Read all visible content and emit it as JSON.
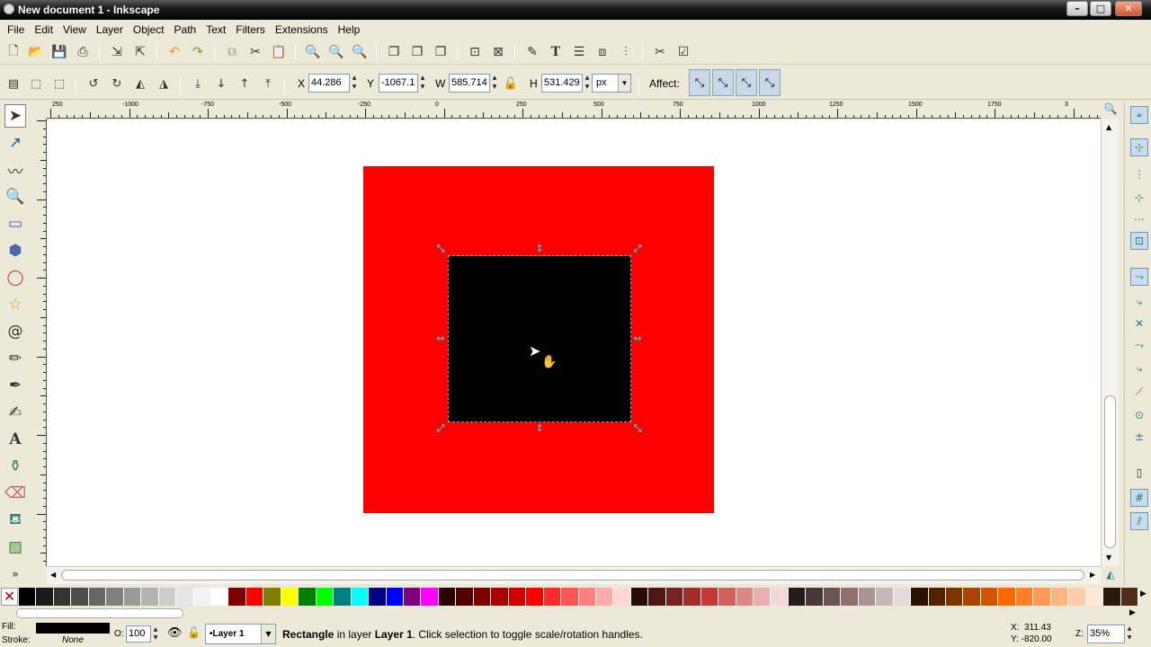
{
  "window": {
    "title": "New document 1 - Inkscape"
  },
  "menu": [
    "File",
    "Edit",
    "View",
    "Layer",
    "Object",
    "Path",
    "Text",
    "Filters",
    "Extensions",
    "Help"
  ],
  "icons": {
    "new": "document-new-icon",
    "open": "folder-open-icon",
    "save": "save-icon",
    "print": "print-icon",
    "import": "import-icon",
    "export": "export-icon",
    "undo": "undo-icon",
    "redo": "redo-icon"
  },
  "controls": {
    "x_label": "X",
    "x_value": "44.286",
    "y_label": "Y",
    "y_value": "-1067.1",
    "w_label": "W",
    "w_value": "585.714",
    "h_label": "H",
    "h_value": "531.429",
    "unit": "px",
    "affect_label": "Affect:"
  },
  "ruler": {
    "labels": [
      "250",
      "-1000",
      "-750",
      "-500",
      "-250",
      "0",
      "250",
      "500",
      "750",
      "1000",
      "1250",
      "1500",
      "1750",
      "3"
    ]
  },
  "canvas": {
    "background_rect_color": "#ff0000",
    "selected_rect_color": "#000000",
    "handle_color": "#35c0d0"
  },
  "palette": {
    "colors": [
      "#000000",
      "#1a1a1a",
      "#333333",
      "#4d4d4d",
      "#666666",
      "#808080",
      "#999999",
      "#b3b3b3",
      "#cccccc",
      "#e6e6e6",
      "#f2f2f2",
      "#ffffff",
      "#800000",
      "#ff0000",
      "#808000",
      "#ffff00",
      "#008000",
      "#00ff00",
      "#008080",
      "#00ffff",
      "#000080",
      "#0000ff",
      "#800080",
      "#ff00ff",
      "#2b0000",
      "#550000",
      "#800000",
      "#aa0000",
      "#d40000",
      "#ff0000",
      "#ff2a2a",
      "#ff5555",
      "#ff8080",
      "#ffaaaa",
      "#ffd5d5",
      "#280b0b",
      "#501616",
      "#782121",
      "#a02c2c",
      "#c83737",
      "#d35f5f",
      "#de8787",
      "#e9afaf",
      "#f4d7d7",
      "#241c1c",
      "#483737",
      "#6c5353",
      "#916f6f",
      "#ac9393",
      "#c8b7b7",
      "#e3dbdb",
      "#2b1100",
      "#552200",
      "#803300",
      "#aa4400",
      "#d45500",
      "#ff6600",
      "#ff7f2a",
      "#ff9955",
      "#ffb380",
      "#ffccaa",
      "#ffe6d5",
      "#28170b",
      "#502d16"
    ]
  },
  "status": {
    "fill_label": "Fill:",
    "stroke_label": "Stroke:",
    "stroke_value": "None",
    "fill_color": "#000000",
    "opacity_label": "O:",
    "opacity_value": "100",
    "layer_value": "•Layer 1",
    "message_bold": "Rectangle",
    "message_mid": " in layer ",
    "message_layer": "Layer 1",
    "message_tail": ". Click selection to toggle scale/rotation handles.",
    "x_coord": "X:  311.43",
    "y_coord": "Y: -820.00",
    "zoom_label": "Z:",
    "zoom_value": "35%"
  }
}
